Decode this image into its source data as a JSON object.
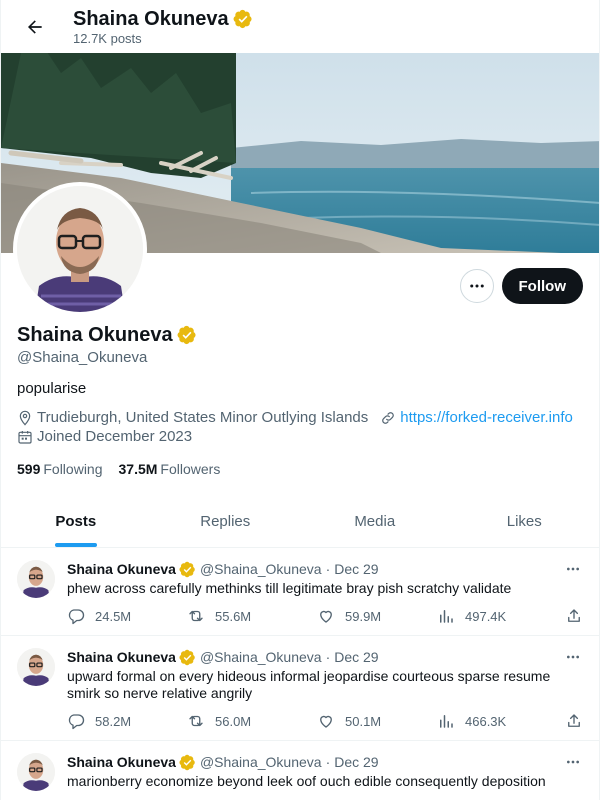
{
  "header": {
    "name": "Shaina Okuneva",
    "post_count": "12.7K posts"
  },
  "profile": {
    "name": "Shaina Okuneva",
    "handle": "@Shaina_Okuneva",
    "bio": "popularise",
    "location": "Trudieburgh, United States Minor Outlying Islands",
    "website": "https://forked-receiver.info",
    "joined": "Joined December 2023",
    "following_count": "599",
    "following_label": "Following",
    "followers_count": "37.5M",
    "followers_label": "Followers",
    "follow_button": "Follow"
  },
  "tabs": [
    {
      "label": "Posts",
      "active": true
    },
    {
      "label": "Replies",
      "active": false
    },
    {
      "label": "Media",
      "active": false
    },
    {
      "label": "Likes",
      "active": false
    }
  ],
  "posts": [
    {
      "name": "Shaina Okuneva",
      "handle": "@Shaina_Okuneva",
      "date": "Dec 29",
      "text": "phew across carefully methinks till legitimate bray pish scratchy validate",
      "replies": "24.5M",
      "reposts": "55.6M",
      "likes": "59.9M",
      "views": "497.4K"
    },
    {
      "name": "Shaina Okuneva",
      "handle": "@Shaina_Okuneva",
      "date": "Dec 29",
      "text": "upward formal on every hideous informal jeopardise courteous sparse resume smirk so nerve relative angrily",
      "replies": "58.2M",
      "reposts": "56.0M",
      "likes": "50.1M",
      "views": "466.3K"
    },
    {
      "name": "Shaina Okuneva",
      "handle": "@Shaina_Okuneva",
      "date": "Dec 29",
      "text": "marionberry economize beyond leek oof ouch edible consequently deposition",
      "replies": "",
      "reposts": "",
      "likes": "",
      "views": ""
    }
  ],
  "colors": {
    "accent": "#1d9bf0",
    "verified": "#e8b90f",
    "text": "#0f1419",
    "muted": "#536471"
  },
  "icons": {
    "back": "arrow-left-icon",
    "verified": "verified-badge-icon",
    "more": "more-icon",
    "location": "location-pin-icon",
    "link": "link-icon",
    "calendar": "calendar-icon",
    "reply": "reply-icon",
    "repost": "repost-icon",
    "like": "heart-icon",
    "views": "views-icon",
    "share": "share-icon"
  }
}
